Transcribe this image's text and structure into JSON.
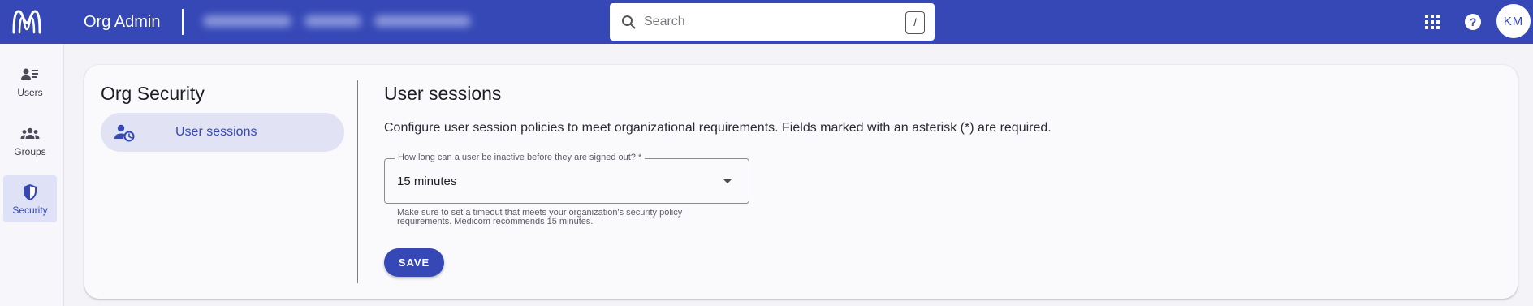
{
  "header": {
    "app_title": "Org Admin",
    "search": {
      "placeholder": "Search",
      "shortcut": "/"
    },
    "avatar_initials": "KM",
    "icons": {
      "logo": "m-logo-icon",
      "apps": "apps-grid-icon",
      "help": "help-icon"
    }
  },
  "sidenav": {
    "items": [
      {
        "label": "Users",
        "icon": "users-list-icon",
        "active": false
      },
      {
        "label": "Groups",
        "icon": "groups-icon",
        "active": false
      },
      {
        "label": "Security",
        "icon": "shield-icon",
        "active": true
      }
    ]
  },
  "panel": {
    "title": "Org Security",
    "items": [
      {
        "label": "User sessions",
        "icon": "user-clock-icon",
        "active": true
      }
    ]
  },
  "main": {
    "title": "User sessions",
    "description": "Configure user session policies to meet organizational requirements. Fields marked with an asterisk (*) are required.",
    "timeout_field": {
      "label": "How long can a user be inactive before they are signed out? *",
      "value": "15 minutes",
      "helper_line1": "Make sure to set a timeout that meets your organization's security policy",
      "helper_line2": "requirements. Medicom recommends 15 minutes."
    },
    "save_label": "SAVE"
  },
  "colors": {
    "brand": "#3548b6",
    "active_bg": "#dfe2f6",
    "page_bg": "#f4f4f8"
  }
}
